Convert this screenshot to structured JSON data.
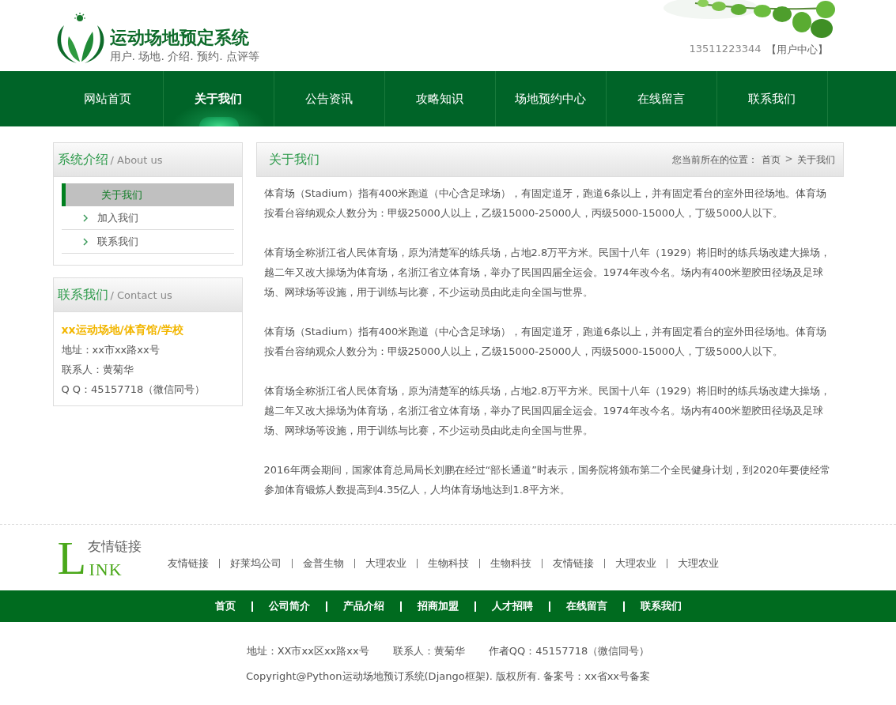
{
  "header": {
    "title": "运动场地预定系统",
    "subtitle": "用户. 场地. 介绍. 预约. 点评等",
    "phone": "13511223344",
    "user_link": "【用户中心】"
  },
  "nav": [
    {
      "label": "网站首页",
      "selected": false
    },
    {
      "label": "关于我们",
      "selected": true
    },
    {
      "label": "公告资讯",
      "selected": false
    },
    {
      "label": "攻略知识",
      "selected": false
    },
    {
      "label": "场地预约中心",
      "selected": false
    },
    {
      "label": "在线留言",
      "selected": false
    },
    {
      "label": "联系我们",
      "selected": false
    }
  ],
  "sidebar": {
    "about": {
      "title": "系统介绍",
      "subtitle": "/ About us",
      "items": [
        {
          "label": "关于我们",
          "selected": true
        },
        {
          "label": "加入我们",
          "selected": false
        },
        {
          "label": "联系我们",
          "selected": false
        }
      ]
    },
    "contact": {
      "title": "联系我们",
      "subtitle": "/ Contact us",
      "company": "xx运动场地/体育馆/学校",
      "lines": [
        "地址：xx市xx路xx号",
        "联系人：黄菊华",
        "Q Q：45157718（微信同号）"
      ]
    }
  },
  "main": {
    "title": "关于我们",
    "breadcrumb": {
      "label": "您当前所在的位置：",
      "home": "首页",
      "separator": ">",
      "current": "关于我们"
    },
    "paragraphs": [
      "体育场（Stadium）指有400米跑道（中心含足球场），有固定道牙，跑道6条以上，并有固定看台的室外田径场地。体育场按看台容纳观众人数分为：甲级25000人以上，乙级15000-25000人，丙级5000-15000人，丁级5000人以下。",
      "体育场全称浙江省人民体育场，原为清楚军的练兵场，占地2.8万平方米。民国十八年（1929）将旧时的练兵场改建大操场，越二年又改大操场为体育场，名浙江省立体育场，举办了民国四届全运会。1974年改今名。场内有400米塑胶田径场及足球场、网球场等设施，用于训练与比赛，不少运动员由此走向全国与世界。",
      "体育场（Stadium）指有400米跑道（中心含足球场），有固定道牙，跑道6条以上，并有固定看台的室外田径场地。体育场按看台容纳观众人数分为：甲级25000人以上，乙级15000-25000人，丙级5000-15000人，丁级5000人以下。",
      "体育场全称浙江省人民体育场，原为清楚军的练兵场，占地2.8万平方米。民国十八年（1929）将旧时的练兵场改建大操场，越二年又改大操场为体育场，名浙江省立体育场，举办了民国四届全运会。1974年改今名。场内有400米塑胶田径场及足球场、网球场等设施，用于训练与比赛，不少运动员由此走向全国与世界。",
      "2016年两会期间，国家体育总局局长刘鹏在经过“部长通道”时表示，国务院将颁布第二个全民健身计划，到2020年要使经常参加体育锻炼人数提高到4.35亿人，人均体育场地达到1.8平方米。"
    ]
  },
  "links": {
    "logo_letter": "L",
    "logo_title": "友情链接",
    "logo_rest": "INK",
    "items": [
      "友情链接",
      "好莱坞公司",
      "金普生物",
      "大理农业",
      "生物科技",
      "生物科技",
      "友情链接",
      "大理农业",
      "大理农业"
    ]
  },
  "footer_nav": [
    "首页",
    "公司简介",
    "产品介绍",
    "招商加盟",
    "人才招聘",
    "在线留言",
    "联系我们"
  ],
  "footer": {
    "address": "地址：XX市xx区xx路xx号",
    "contact": "联系人：黄菊华",
    "qq": "作者QQ：45157718（微信同号）",
    "copyright": "Copyright@Python运动场地预订系统(Django框架). 版权所有. 备案号：xx省xx号备案"
  }
}
